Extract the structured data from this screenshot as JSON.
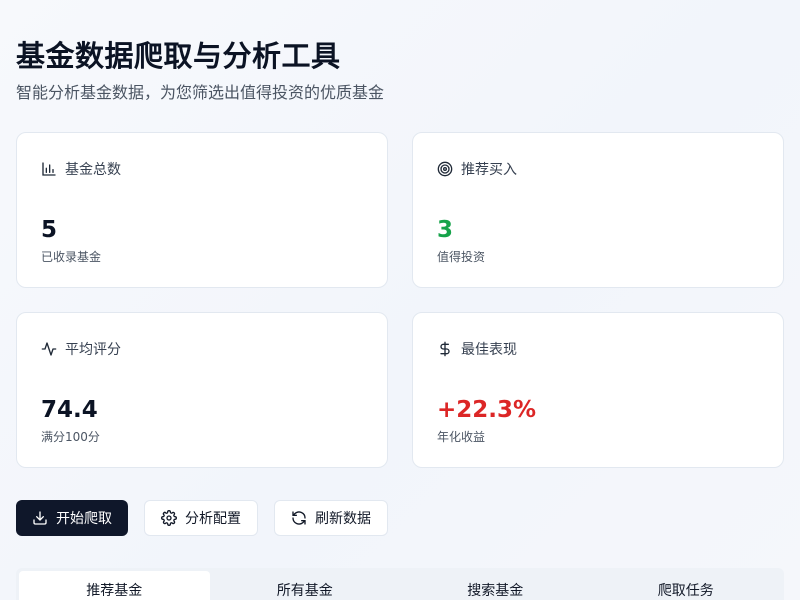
{
  "header": {
    "title": "基金数据爬取与分析工具",
    "subtitle": "智能分析基金数据，为您筛选出值得投资的优质基金"
  },
  "stats": [
    {
      "label": "基金总数",
      "value": "5",
      "sub": "已收录基金",
      "icon": "bar-chart-icon"
    },
    {
      "label": "推荐买入",
      "value": "3",
      "sub": "值得投资",
      "icon": "target-icon",
      "value_color": "#16a34a"
    },
    {
      "label": "平均评分",
      "value": "74.4",
      "sub": "满分100分",
      "icon": "activity-icon"
    },
    {
      "label": "最佳表现",
      "value": "+22.3%",
      "sub": "年化收益",
      "icon": "dollar-icon",
      "value_color": "#dc2626"
    }
  ],
  "actions": {
    "start_crawl": "开始爬取",
    "analysis_config": "分析配置",
    "refresh_data": "刷新数据"
  },
  "tabs": [
    {
      "label": "推荐基金",
      "active": true
    },
    {
      "label": "所有基金",
      "active": false
    },
    {
      "label": "搜索基金",
      "active": false
    },
    {
      "label": "爬取任务",
      "active": false
    }
  ]
}
